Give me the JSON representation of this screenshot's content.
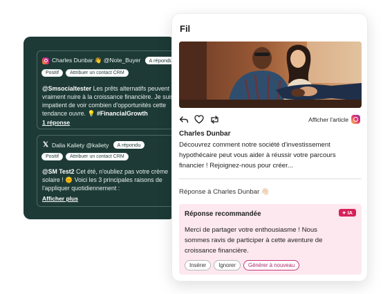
{
  "dark_panel": {
    "messages": [
      {
        "network_icon": "instagram-icon",
        "header": "Charles Dunbar 👋 @Note_Buyer",
        "status": "A répondu",
        "tags": [
          "Positif",
          "Attribuer un contact CRM"
        ],
        "mention": "@Smsocialtester",
        "body_line1": " Les prêts alternatifs peuvent",
        "body_line2": "vraiment nuire à la croissance financière. Je suis",
        "body_line3": "impatient de voir combien d'opportunités cette",
        "body_line4_prefix": "tendance ouvre. 💡 ",
        "hashtag": "#FinancialGrowth",
        "link": "1 réponse"
      },
      {
        "network_icon": "x-icon",
        "header": "Dalia Kaliety @kaliety",
        "status": "A répondu",
        "tags": [
          "Positif",
          "Attribuer un contact CRM"
        ],
        "mention": "@SM Test2",
        "body_line1": " Cet été, n'oubliez pas votre crème",
        "body_line2": "solaire ! 🌞 Voici les 3 principales raisons de",
        "body_line3": "l'appliquer quotidiennement :",
        "link": "Afficher plus"
      }
    ]
  },
  "feed": {
    "title": "Fil",
    "view_article": "Afficher l'article",
    "author": "Charles Dunbar",
    "post_line1": "Découvrez comment notre société d'investissement",
    "post_line2": "hypothécaire peut vous aider à réussir votre parcours",
    "post_line3": "financier ! Rejoignez-nous pour créer...",
    "reply_to": "Réponse à Charles Dunbar 👋🏻",
    "recommended": {
      "title": "Réponse recommandée",
      "badge": "✦ IA",
      "line1": "Merci de partager votre enthousiasme ! Nous",
      "line2": "sommes ravis de participer à cette aventure de",
      "line3": "croissance financière.",
      "buttons": [
        "Insérer",
        "Ignorer",
        "Générer à nouveau"
      ]
    }
  },
  "colors": {
    "panel_bg": "#1d3a36",
    "accent_pink": "#d6215a",
    "reco_bg": "#fde8ef"
  }
}
